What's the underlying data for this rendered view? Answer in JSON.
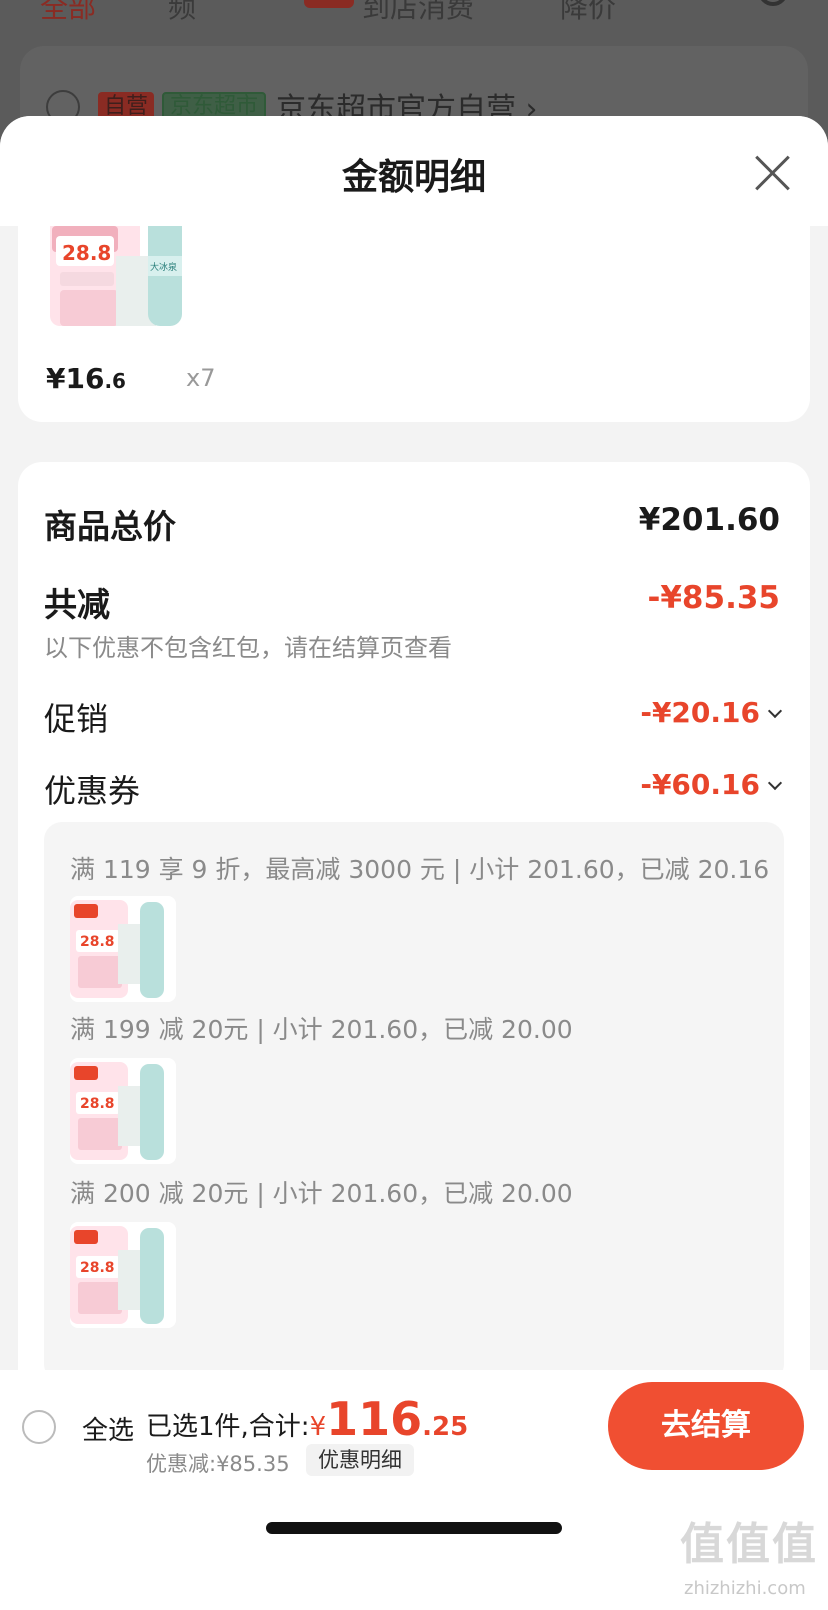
{
  "background": {
    "tabs": [
      "全部",
      "频",
      "到店消费",
      "降价"
    ],
    "store_tag_self": "自营",
    "store_tag_market": "京东超市",
    "store_name": "京东超市官方自营"
  },
  "sheet": {
    "title": "金额明细"
  },
  "product": {
    "promo_price_text": "28.8",
    "image_brand_text": "大冰泉",
    "price_int": "¥16",
    "price_dec": ".6",
    "quantity": "x7"
  },
  "details": {
    "total_label": "商品总价",
    "total_value": "¥201.60",
    "reduced_label": "共减",
    "reduced_value": "-¥85.35",
    "note": "以下优惠不包含红包，请在结算页查看",
    "promo_label": "促销",
    "promo_value": "-¥20.16",
    "coupon_label": "优惠券",
    "coupon_value": "-¥60.16"
  },
  "coupon_items": [
    {
      "text": "满 119 享 9 折，最高减 3000 元 | 小计 201.60，已减 20.16"
    },
    {
      "text": "满 199 减 20元 | 小计 201.60，已减 20.00"
    },
    {
      "text": "满 200 减 20元 | 小计 201.60，已减 20.00"
    }
  ],
  "bottom": {
    "select_all": "全选",
    "selected_text": "已选1件,合计:",
    "currency": "¥",
    "total_int": "116",
    "total_dec": ".25",
    "discount_text": "优惠减:¥85.35",
    "detail_link": "优惠明细",
    "checkout": "去结算"
  },
  "watermark": {
    "main": "值值值",
    "sub": "zhizhizhi.com"
  },
  "colors": {
    "accent_red": "#e8452b",
    "checkout_btn": "#f04f32"
  }
}
